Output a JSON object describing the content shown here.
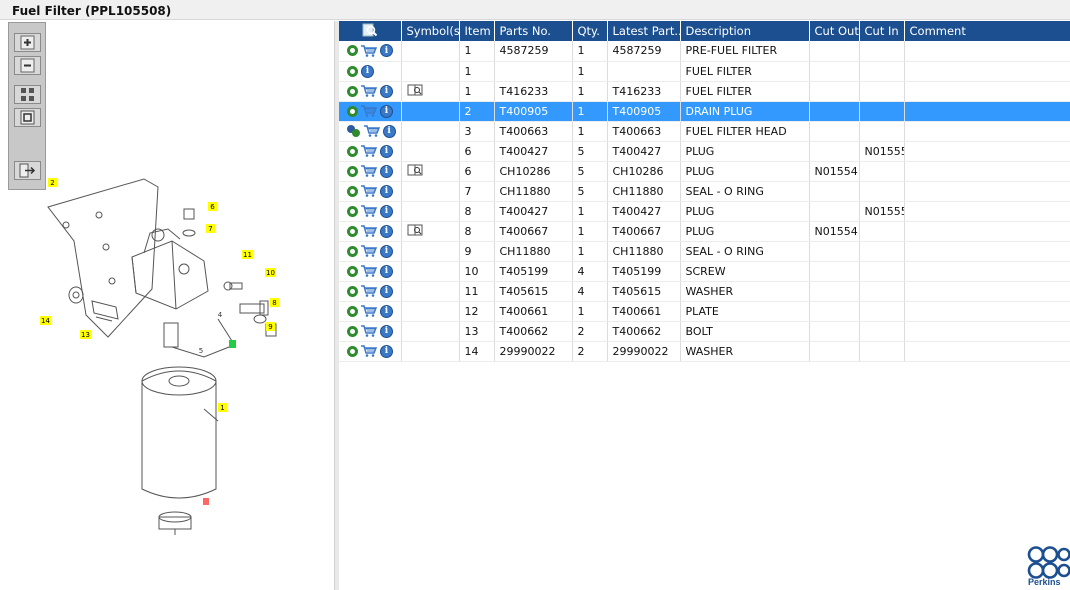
{
  "window": {
    "title": "Fuel Filter (PPL105508)"
  },
  "toolbar": {
    "buttons": [
      {
        "icon": "zoom-in-icon"
      },
      {
        "icon": "zoom-out-icon"
      },
      {
        "icon": "fit-all-icon"
      },
      {
        "icon": "fit-window-icon"
      },
      {
        "icon": "export-icon"
      }
    ]
  },
  "diagram": {
    "callouts": [
      "1",
      "2",
      "4",
      "5",
      "6",
      "7",
      "8",
      "9",
      "10",
      "11",
      "12",
      "13",
      "14"
    ],
    "highlight_color": "#ffff00",
    "selected_callout_color": "#ff6666"
  },
  "table": {
    "headers": [
      "",
      "Symbol(s)",
      "Item",
      "Parts No.",
      "Qty.",
      "Latest Part...",
      "Description",
      "Cut Out",
      "Cut In",
      "Comment"
    ],
    "rows": [
      {
        "icons": "gear-cart-info",
        "symbol": "",
        "item": "1",
        "part": "4587259",
        "qty": "1",
        "latest": "4587259",
        "desc": "PRE-FUEL FILTER",
        "cutout": "",
        "cutin": "",
        "comment": ""
      },
      {
        "icons": "gear-info",
        "symbol": "",
        "item": "1",
        "part": "",
        "qty": "1",
        "latest": "",
        "desc": "FUEL FILTER",
        "cutout": "",
        "cutin": "",
        "comment": ""
      },
      {
        "icons": "gear-cart-info",
        "symbol": "book",
        "item": "1",
        "part": "T416233",
        "qty": "1",
        "latest": "T416233",
        "desc": "FUEL FILTER",
        "cutout": "",
        "cutin": "",
        "comment": ""
      },
      {
        "icons": "gear-cart-info",
        "symbol": "",
        "item": "2",
        "part": "T400905",
        "qty": "1",
        "latest": "T400905",
        "desc": "DRAIN PLUG",
        "cutout": "",
        "cutin": "",
        "comment": "",
        "selected": true
      },
      {
        "icons": "gears-cart-info",
        "symbol": "",
        "item": "3",
        "part": "T400663",
        "qty": "1",
        "latest": "T400663",
        "desc": "FUEL FILTER HEAD",
        "cutout": "",
        "cutin": "",
        "comment": ""
      },
      {
        "icons": "gear-cart-info",
        "symbol": "",
        "item": "6",
        "part": "T400427",
        "qty": "5",
        "latest": "T400427",
        "desc": "PLUG",
        "cutout": "",
        "cutin": "N01555",
        "comment": ""
      },
      {
        "icons": "gear-cart-info",
        "symbol": "book",
        "item": "6",
        "part": "CH10286",
        "qty": "5",
        "latest": "CH10286",
        "desc": "PLUG",
        "cutout": "N01554",
        "cutin": "",
        "comment": ""
      },
      {
        "icons": "gear-cart-info",
        "symbol": "",
        "item": "7",
        "part": "CH11880",
        "qty": "5",
        "latest": "CH11880",
        "desc": "SEAL - O RING",
        "cutout": "",
        "cutin": "",
        "comment": ""
      },
      {
        "icons": "gear-cart-info",
        "symbol": "",
        "item": "8",
        "part": "T400427",
        "qty": "1",
        "latest": "T400427",
        "desc": "PLUG",
        "cutout": "",
        "cutin": "N01555",
        "comment": ""
      },
      {
        "icons": "gear-cart-info",
        "symbol": "book",
        "item": "8",
        "part": "T400667",
        "qty": "1",
        "latest": "T400667",
        "desc": "PLUG",
        "cutout": "N01554",
        "cutin": "",
        "comment": ""
      },
      {
        "icons": "gear-cart-info",
        "symbol": "",
        "item": "9",
        "part": "CH11880",
        "qty": "1",
        "latest": "CH11880",
        "desc": "SEAL - O RING",
        "cutout": "",
        "cutin": "",
        "comment": ""
      },
      {
        "icons": "gear-cart-info",
        "symbol": "",
        "item": "10",
        "part": "T405199",
        "qty": "4",
        "latest": "T405199",
        "desc": "SCREW",
        "cutout": "",
        "cutin": "",
        "comment": ""
      },
      {
        "icons": "gear-cart-info",
        "symbol": "",
        "item": "11",
        "part": "T405615",
        "qty": "4",
        "latest": "T405615",
        "desc": "WASHER",
        "cutout": "",
        "cutin": "",
        "comment": ""
      },
      {
        "icons": "gear-cart-info",
        "symbol": "",
        "item": "12",
        "part": "T400661",
        "qty": "1",
        "latest": "T400661",
        "desc": "PLATE",
        "cutout": "",
        "cutin": "",
        "comment": ""
      },
      {
        "icons": "gear-cart-info",
        "symbol": "",
        "item": "13",
        "part": "T400662",
        "qty": "2",
        "latest": "T400662",
        "desc": "BOLT",
        "cutout": "",
        "cutin": "",
        "comment": ""
      },
      {
        "icons": "gear-cart-info",
        "symbol": "",
        "item": "14",
        "part": "29990022",
        "qty": "2",
        "latest": "29990022",
        "desc": "WASHER",
        "cutout": "",
        "cutin": "",
        "comment": ""
      }
    ]
  },
  "brand": {
    "name": "Perkins",
    "color": "#1b4f90"
  },
  "colors": {
    "header_bg": "#1b4f90",
    "selected_row": "#3399ff",
    "gear_green": "#2e8b2e",
    "info_blue": "#3a78c8"
  }
}
